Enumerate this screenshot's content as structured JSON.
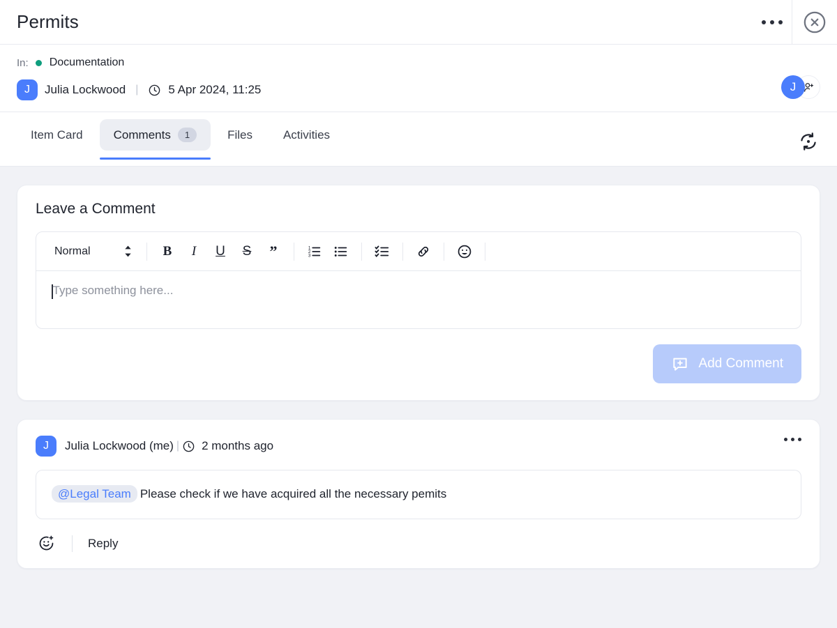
{
  "header": {
    "title": "Permits",
    "more_icon": "ellipsis-icon",
    "close_icon": "close-circle-icon"
  },
  "meta": {
    "in_label": "In:",
    "location": "Documentation",
    "location_dot_color": "#0f9e7e",
    "author_initial": "J",
    "author": "Julia Lockwood",
    "separator": "|",
    "date": "5 Apr 2024, 11:25",
    "clock_icon": "clock-icon",
    "participant_initial": "J",
    "add_person_icon": "person-add-icon"
  },
  "tabs": {
    "items": [
      {
        "label": "Item Card",
        "badge": null,
        "active": false
      },
      {
        "label": "Comments",
        "badge": "1",
        "active": true
      },
      {
        "label": "Files",
        "badge": null,
        "active": false
      },
      {
        "label": "Activities",
        "badge": null,
        "active": false
      }
    ],
    "refresh_icon": "refresh-icon"
  },
  "compose": {
    "heading": "Leave a Comment",
    "style_value": "Normal",
    "style_chevron_icon": "chevron-up-down-icon",
    "tools": [
      {
        "name": "bold-button",
        "glyph": "B",
        "kind": "b"
      },
      {
        "name": "italic-button",
        "glyph": "I",
        "kind": "i"
      },
      {
        "name": "underline-button",
        "glyph": "U",
        "kind": "u"
      },
      {
        "name": "strikethrough-button",
        "glyph": "S",
        "kind": "s"
      },
      {
        "name": "blockquote-button",
        "glyph": "”",
        "kind": "q"
      }
    ],
    "placeholder": "Type something here...",
    "submit_label": "Add Comment",
    "submit_icon": "comment-plus-icon",
    "submit_color": "#b7cbfb"
  },
  "comment": {
    "avatar_initial": "J",
    "author": "Julia Lockwood (me)",
    "separator": "|",
    "time": "2 months ago",
    "clock_icon": "clock-icon",
    "more_icon": "ellipsis-icon",
    "mention": "@Legal Team",
    "text": "Please check if we have acquired all the necessary pemits",
    "react_icon": "emoji-plus-icon",
    "reply_label": "Reply"
  },
  "theme": {
    "accent": "#4a7dfc",
    "page_bg": "#f1f2f6",
    "card_bg": "#ffffff"
  }
}
